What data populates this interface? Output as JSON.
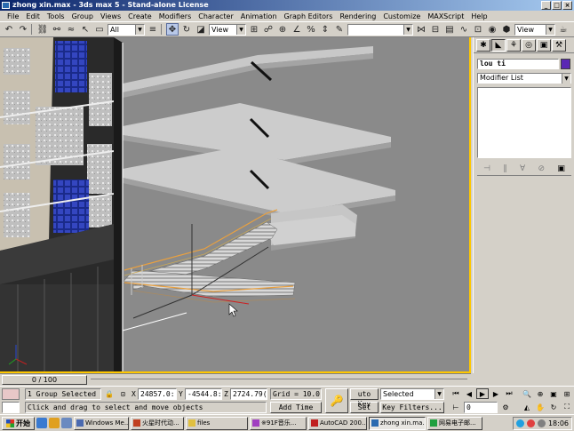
{
  "window": {
    "title": "zhong xin.max - 3ds max 5 - Stand-alone License"
  },
  "menu": [
    "File",
    "Edit",
    "Tools",
    "Group",
    "Views",
    "Create",
    "Modifiers",
    "Character",
    "Animation",
    "Graph Editors",
    "Rendering",
    "Customize",
    "MAXScript",
    "Help"
  ],
  "toolbar": {
    "selection_filter": "All",
    "ref_coord": "View",
    "named_selection": "",
    "ref_coord_right": "View"
  },
  "command_panel": {
    "object_name": "lou ti",
    "object_color": "#5a28b4",
    "modifier_list": "Modifier List"
  },
  "time_slider": {
    "label": "0 / 100"
  },
  "status": {
    "selection_info": "1 Group Selected",
    "prompt": "Click and drag to select and move objects",
    "x_label": "X",
    "x_value": "24857.0:",
    "y_label": "Y",
    "y_value": "-4544.8:",
    "z_label": "Z",
    "z_value": "2724.79(",
    "grid": "Grid = 10.0",
    "add_time_tag": "Add Time Tag",
    "auto_key": "uto Key",
    "set_key": "Set Key",
    "key_mode": "Selected",
    "key_filters": "Key Filters...",
    "current_frame": "0"
  },
  "taskbar": {
    "start": "开始",
    "tasks": [
      "Windows Me...",
      "火星时代动...",
      "files",
      "※91F音乐...",
      "AutoCAD 200...",
      "zhong xin.ma...",
      "网易电子邮..."
    ],
    "clock": "18:06"
  }
}
